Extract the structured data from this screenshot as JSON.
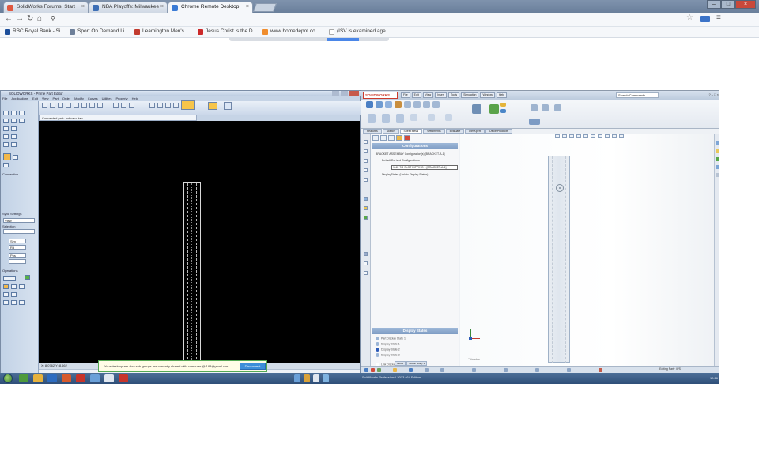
{
  "browser": {
    "tabs": [
      {
        "label": "SolidWorks Forums: Start",
        "color": "#e0583f"
      },
      {
        "label": "NBA Playoffs: Milwaukee",
        "color": "#3d6fb6"
      },
      {
        "label": "Chrome Remote Desktop",
        "color": "#3a7bd5"
      }
    ],
    "address": "",
    "bookmarks": [
      {
        "label": "RBC Royal Bank - Si...",
        "color": "#1c4e9a"
      },
      {
        "label": "Sport On Demand Li...",
        "color": "#6d7f99"
      },
      {
        "label": "Leamington Men's ...",
        "color": "#c23b2f"
      },
      {
        "label": "Jesus Christ is the D...",
        "color": "#cc2a2a"
      },
      {
        "label": "www.homedepot.co...",
        "color": "#f08d2e"
      },
      {
        "label": "(ISV is examined age...",
        "color": "#cccccc"
      }
    ]
  },
  "remote": {
    "left_window": {
      "title": "SOLIDWORKS - Prime Part Editor",
      "menu": [
        "File",
        "Applications",
        "Edit",
        "View",
        "Part",
        "Order",
        "Modify",
        "Curves",
        "Utilities",
        "Property",
        "Help"
      ],
      "tab": "Connected part: Indicator tab",
      "status": "X: 8.0762 Y: 8.662",
      "side_labels": [
        "Connection",
        "Sync Settings",
        "Selection",
        "Operations"
      ],
      "sync_fields": [
        "View",
        "Sim",
        "Rd",
        "Pos"
      ]
    },
    "notification": {
      "text": "Your desktop are also sub-groups are currently shared with computer @ 183@ymail.com",
      "button": "Disconnect"
    },
    "right_window": {
      "logo": "SOLIDWORKS",
      "menu": [
        "File",
        "Edit",
        "View",
        "Insert",
        "Tools",
        "Simulation",
        "Window",
        "Help"
      ],
      "search": "Search Commands",
      "command_tabs": [
        "Features",
        "Sketch",
        "Sheet Metal",
        "Weldments",
        "Evaluate",
        "DimXpert",
        "Office Products"
      ],
      "config_title": "Configurations",
      "tree": [
        "BRACKET ASSEMBLY Configuration(s) [BRACKET-A-1]",
        "Default Derived Configurations",
        "1-4X 7/8 SLOT RIPPING 1 [BRACKET-A-1]",
        "DisplayStates (Link to Display States)"
      ],
      "display_title": "Display States",
      "display_states": [
        "Part Display State 1",
        "Display State-1",
        "Display State-2",
        "Display State-3"
      ],
      "display_note": "Link Display States to Configuration",
      "bottom_tabs": [
        "Model",
        "Motion Study 1"
      ],
      "view_label": "*Trimetric",
      "status": "SolidWorks Professional 2013 x64 Edition",
      "status_right": "Editing Part",
      "unit": "IPS"
    },
    "taskbar": {
      "clock": "10:26"
    }
  }
}
